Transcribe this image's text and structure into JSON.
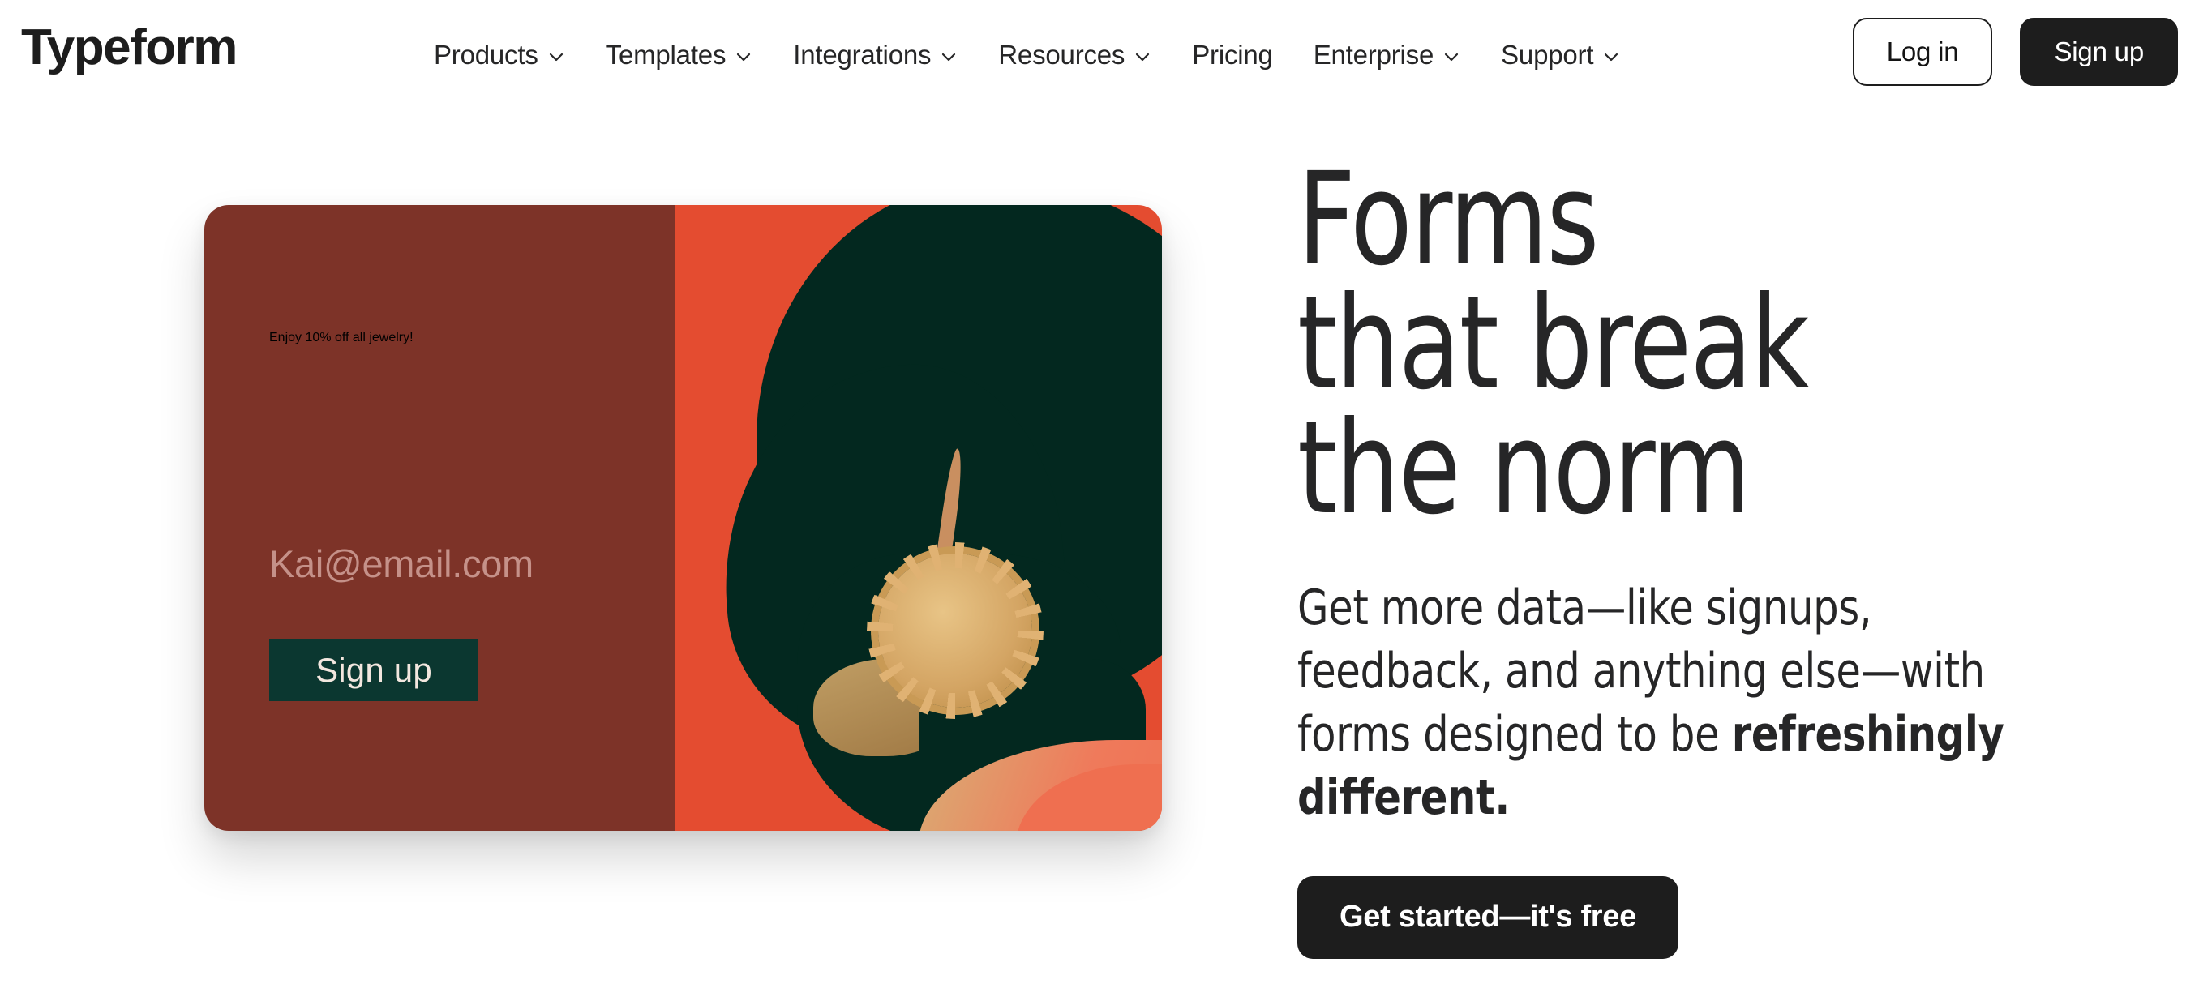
{
  "brand": {
    "name": "Typeform"
  },
  "nav": {
    "items": [
      {
        "label": "Products",
        "has_caret": true,
        "icon": "chevron-down-icon"
      },
      {
        "label": "Templates",
        "has_caret": true,
        "icon": "chevron-down-icon"
      },
      {
        "label": "Integrations",
        "has_caret": true,
        "icon": "chevron-down-icon"
      },
      {
        "label": "Resources",
        "has_caret": true,
        "icon": "chevron-down-icon"
      },
      {
        "label": "Pricing",
        "has_caret": false,
        "icon": ""
      },
      {
        "label": "Enterprise",
        "has_caret": true,
        "icon": "chevron-down-icon"
      },
      {
        "label": "Support",
        "has_caret": true,
        "icon": "chevron-down-icon"
      }
    ]
  },
  "auth": {
    "login_label": "Log in",
    "signup_label": "Sign up"
  },
  "hero": {
    "title": "Forms\nthat break\nthe norm",
    "subtitle_lead": "Get more data—like signups, feedback, and anything else—with forms designed to be ",
    "subtitle_emphasis": "refreshingly different.",
    "cta_label": "Get started—it's free"
  },
  "preview_card": {
    "form_headline": "Enjoy 10% off\nall jewelry!",
    "email_placeholder": "Kai@email.com",
    "submit_label": "Sign up",
    "image_alt": "portrait-silhouette-with-gold-earring"
  },
  "colors": {
    "page_background": "#ffffff",
    "text_primary": "#262627",
    "button_dark": "#1d1d1d",
    "card_panel_red": "#7d3328",
    "card_photo_orange": "#e44c30",
    "card_silhouette_green": "#03281f",
    "card_cream_text": "#f6e7de",
    "card_placeholder_text": "#c59189",
    "card_submit_green": "#0b3730",
    "earring_gold": "#d4a564"
  }
}
